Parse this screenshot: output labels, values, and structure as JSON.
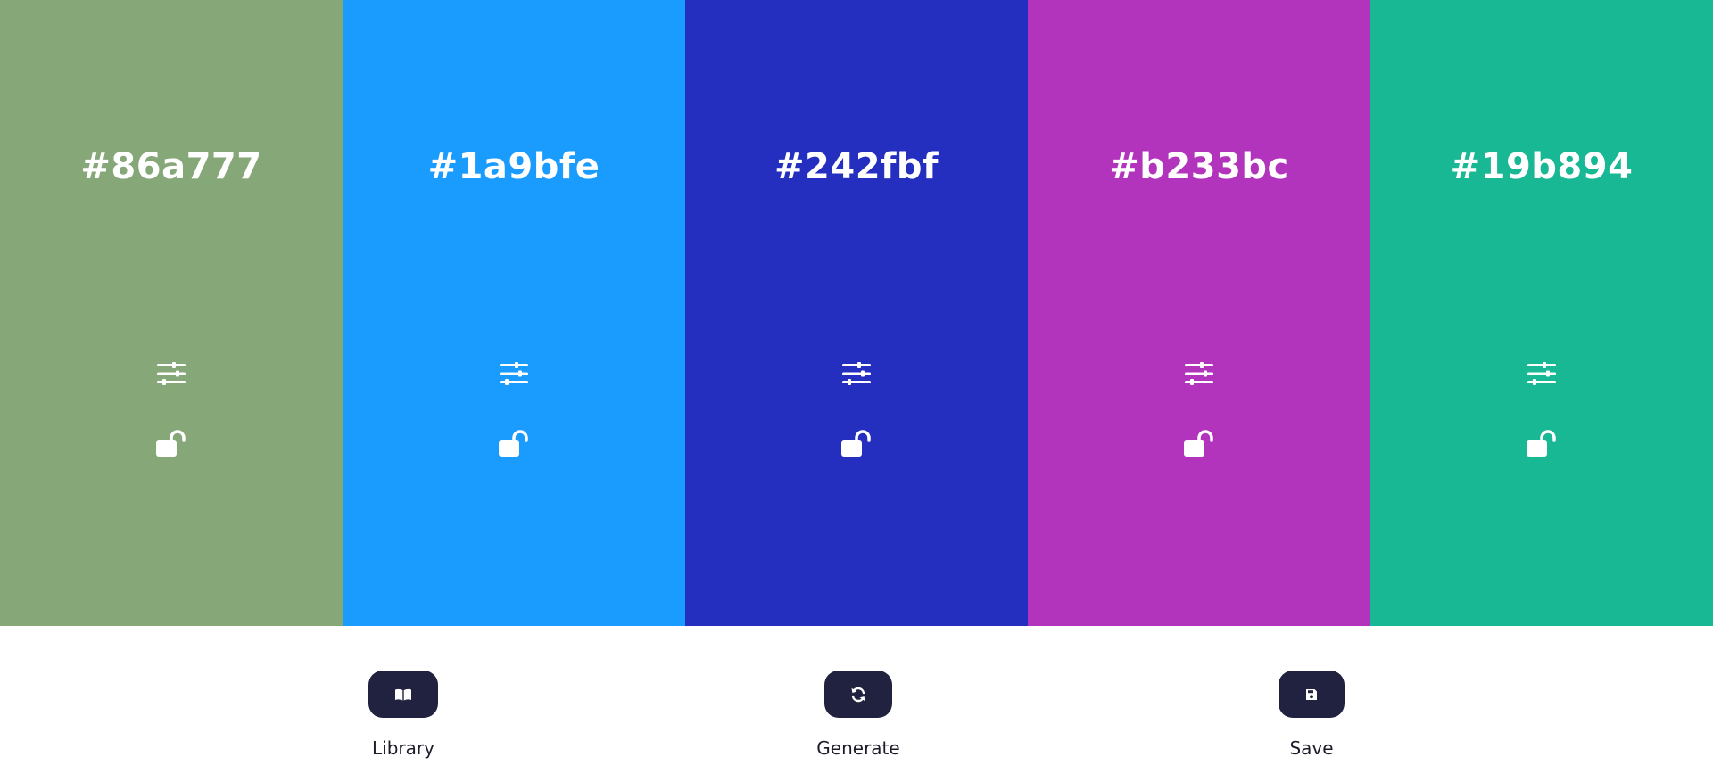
{
  "palette": {
    "colors": [
      {
        "hex": "#86a777"
      },
      {
        "hex": "#1a9bfe"
      },
      {
        "hex": "#242fbf"
      },
      {
        "hex": "#b233bc"
      },
      {
        "hex": "#19b894"
      }
    ],
    "adjust_icon": "sliders-icon",
    "lock_icon": "unlocked-padlock-icon",
    "text_color": "#ffffff"
  },
  "toolbar": {
    "library_label": "Library",
    "generate_label": "Generate",
    "save_label": "Save",
    "library_icon": "book-icon",
    "generate_icon": "refresh-icon",
    "save_icon": "floppy-disk-icon",
    "button_color": "#21223f"
  }
}
